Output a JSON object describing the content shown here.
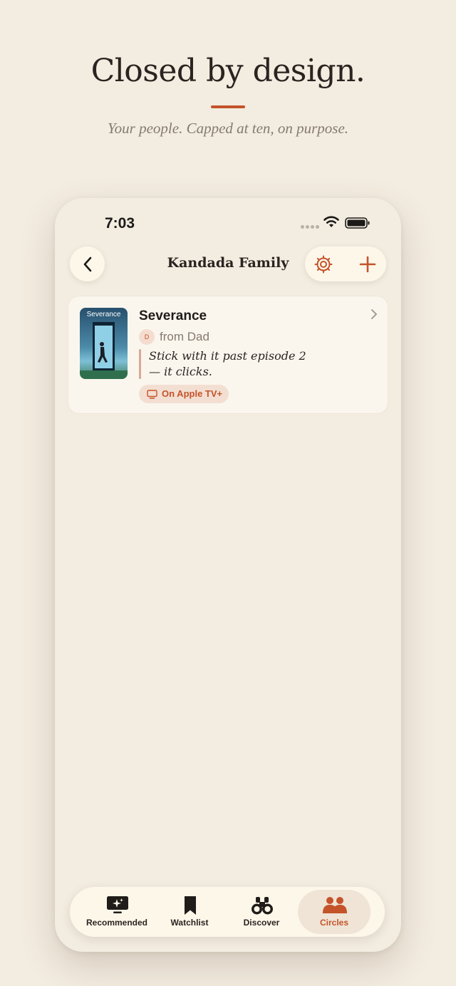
{
  "hero": {
    "title": "Closed by design.",
    "subtitle": "Your people. Capped at ten, on purpose."
  },
  "status_bar": {
    "time": "7:03"
  },
  "nav": {
    "back_icon": "chevron-left-icon",
    "title": "Kandada Family",
    "settings_icon": "gear-icon",
    "add_icon": "plus-icon"
  },
  "recommendation": {
    "title": "Severance",
    "poster_text": "Severance",
    "sender_initial": "D",
    "from": "from Dad",
    "note": "Stick with it past episode 2 — it clicks.",
    "service": "On Apple TV+",
    "service_icon": "tv-icon"
  },
  "tabbar": {
    "items": [
      {
        "label": "Recommended",
        "icon": "recommended-tv-icon",
        "active": false
      },
      {
        "label": "Watchlist",
        "icon": "bookmark-icon",
        "active": false
      },
      {
        "label": "Discover",
        "icon": "binoculars-icon",
        "active": false
      },
      {
        "label": "Circles",
        "icon": "people-icon",
        "active": true
      }
    ]
  },
  "colors": {
    "background": "#f3ece0",
    "accent": "#c4532a",
    "card": "#faf6ee",
    "text": "#2a2320",
    "muted": "#857a70"
  }
}
